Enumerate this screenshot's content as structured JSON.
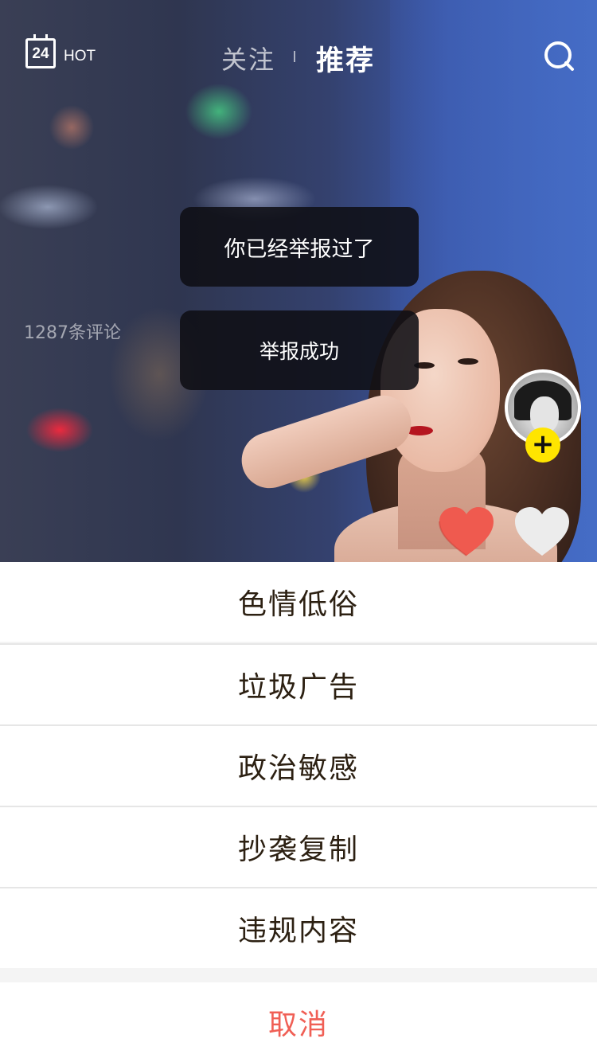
{
  "header": {
    "calendar_day": "24",
    "hot_label": "HOT",
    "tabs": [
      {
        "label": "关注",
        "active": false
      },
      {
        "label": "推荐",
        "active": true
      }
    ]
  },
  "post": {
    "comment_count_label": "1287条评论"
  },
  "toasts": [
    {
      "text": "你已经举报过了"
    },
    {
      "text": "举报成功"
    }
  ],
  "report_sheet": {
    "options": [
      {
        "label": "色情低俗"
      },
      {
        "label": "垃圾广告"
      },
      {
        "label": "政治敏感"
      },
      {
        "label": "抄袭复制"
      },
      {
        "label": "违规内容"
      }
    ],
    "cancel_label": "取消"
  },
  "colors": {
    "accent_yellow": "#ffe500",
    "heart_red": "#ef5a4f",
    "cancel_red": "#f05f55",
    "sheet_text": "#2c2012"
  },
  "icons": {
    "calendar": "calendar-icon",
    "search": "search-icon",
    "follow": "plus-icon",
    "like": "heart-icon"
  }
}
